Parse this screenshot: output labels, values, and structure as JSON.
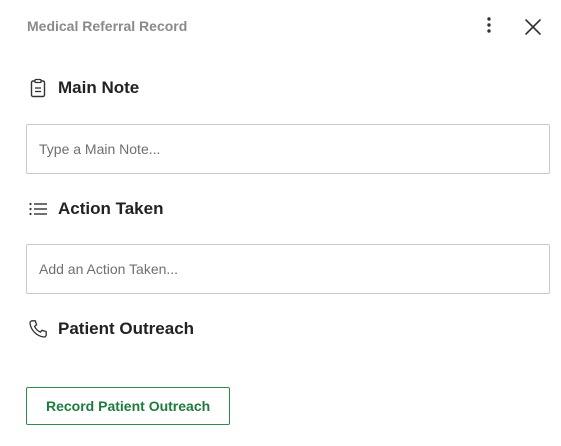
{
  "header": {
    "title": "Medical Referral Record",
    "more_icon": "vertical-dots-icon",
    "close_icon": "close-icon"
  },
  "main_note": {
    "label": "Main Note",
    "icon": "clipboard-icon",
    "placeholder": "Type a Main Note...",
    "value": ""
  },
  "action_taken": {
    "label": "Action Taken",
    "icon": "list-icon",
    "placeholder": "Add an Action Taken...",
    "value": ""
  },
  "patient_outreach": {
    "label": "Patient Outreach",
    "icon": "phone-icon",
    "button_label": "Record Patient Outreach"
  },
  "colors": {
    "title_gray": "#8a8a8a",
    "accent_green": "#1f7a3d",
    "border_gray": "#c9c9c9"
  }
}
